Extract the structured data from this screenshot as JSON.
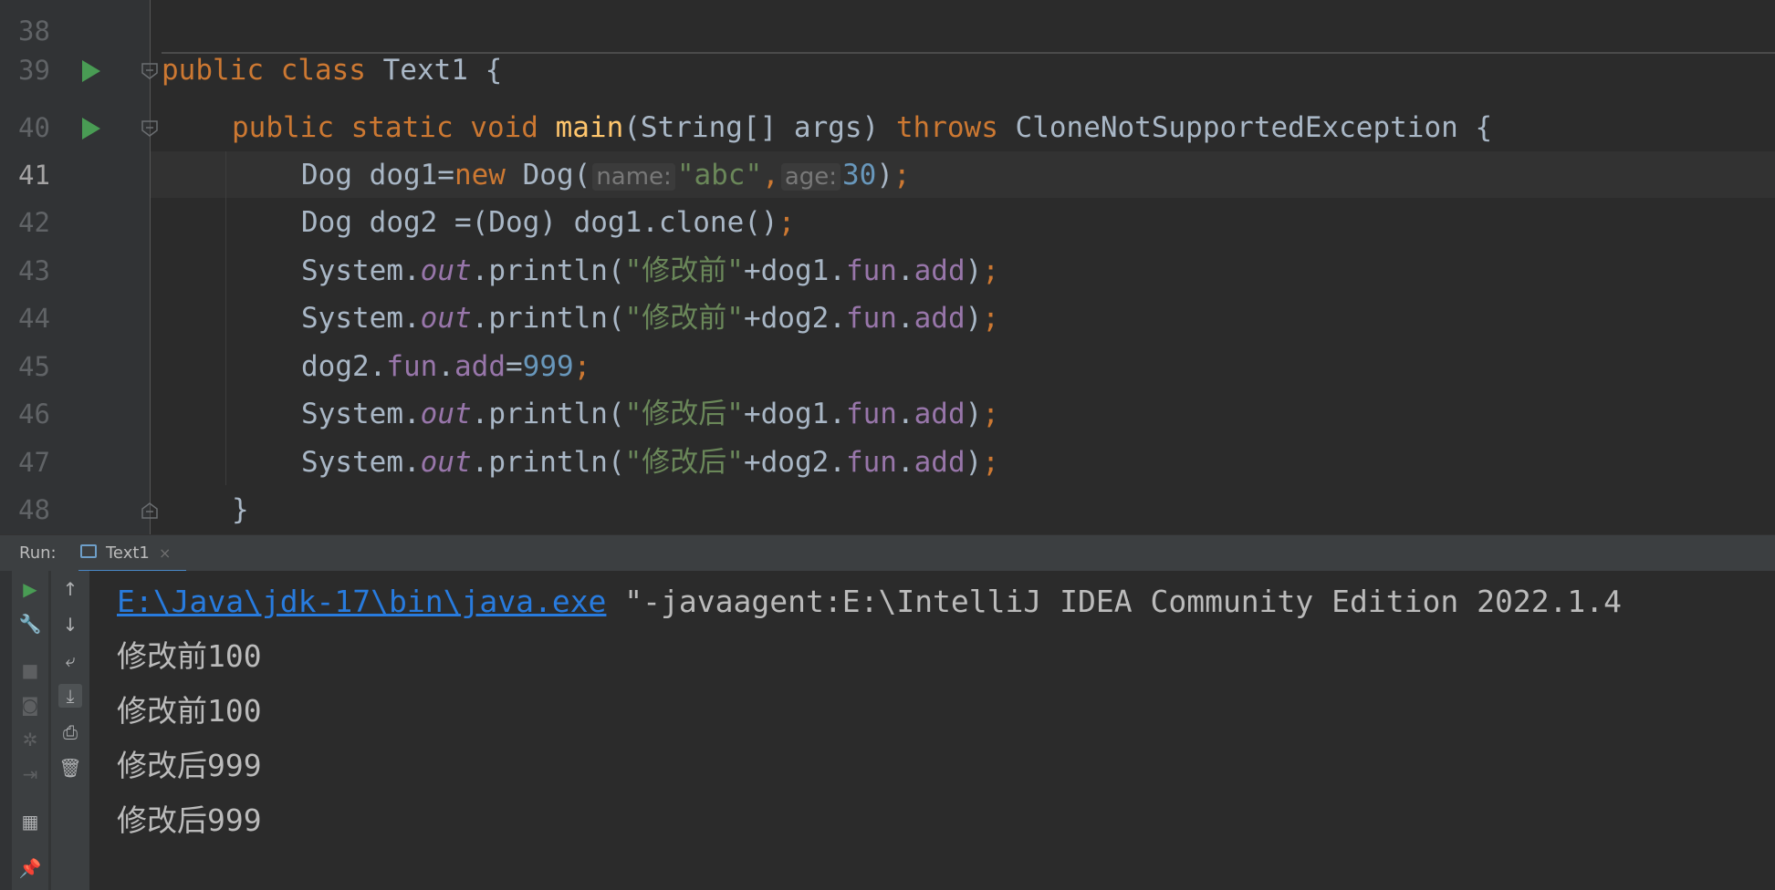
{
  "editor": {
    "line_numbers": [
      "38",
      "39",
      "40",
      "41",
      "42",
      "43",
      "44",
      "45",
      "46",
      "47",
      "48"
    ],
    "l39": {
      "public": "public",
      "class": "class",
      "name": " Text1 {"
    },
    "l40": {
      "mods": "public static void ",
      "method": "main",
      "params": "(String[] args) ",
      "throws": "throws",
      "exc": " CloneNotSupportedException {"
    },
    "l41": {
      "a": "Dog dog1=",
      "new": "new",
      "b": " Dog(",
      "hint_name": "name:",
      "str": "\"abc\"",
      "comma": ",",
      "hint_age": "age:",
      "num": "30",
      "close": ")",
      "semi": ";"
    },
    "l42": {
      "a": "Dog dog2 =(Dog) dog1.clone()",
      "semi": ";"
    },
    "l43": {
      "sys": "System.",
      "out": "out",
      "println": ".println(",
      "str": "\"修改前\"",
      "a": "+dog1.",
      "fun": "fun",
      "dot": ".",
      "add": "add",
      "close": ")",
      "semi": ";"
    },
    "l44": {
      "sys": "System.",
      "out": "out",
      "println": ".println(",
      "str": "\"修改前\"",
      "a": "+dog2.",
      "fun": "fun",
      "dot": ".",
      "add": "add",
      "close": ")",
      "semi": ";"
    },
    "l45": {
      "a": "dog2.",
      "fun": "fun",
      "dot": ".",
      "add": "add",
      "eq": "=",
      "num": "999",
      "semi": ";"
    },
    "l46": {
      "sys": "System.",
      "out": "out",
      "println": ".println(",
      "str": "\"修改后\"",
      "a": "+dog1.",
      "fun": "fun",
      "dot": ".",
      "add": "add",
      "close": ")",
      "semi": ";"
    },
    "l47": {
      "sys": "System.",
      "out": "out",
      "println": ".println(",
      "str": "\"修改后\"",
      "a": "+dog2.",
      "fun": "fun",
      "dot": ".",
      "add": "add",
      "close": ")",
      "semi": ";"
    },
    "l48": {
      "brace": "}"
    }
  },
  "run_panel": {
    "label": "Run:",
    "tab_label": "Text1",
    "tab_close": "×"
  },
  "console": {
    "cmd_link": "E:\\Java\\jdk-17\\bin\\java.exe",
    "cmd_rest": " \"-javaagent:E:\\IntelliJ IDEA Community Edition 2022.1.4",
    "output": [
      "修改前100",
      "修改前100",
      "修改后999",
      "修改后999"
    ]
  },
  "colors": {
    "background": "#2b2b2b",
    "keyword": "#cc7832",
    "string": "#6a8759",
    "number": "#6897bb",
    "field": "#9876aa",
    "method": "#ffc66d",
    "link": "#287bde",
    "run_green": "#499c54"
  }
}
